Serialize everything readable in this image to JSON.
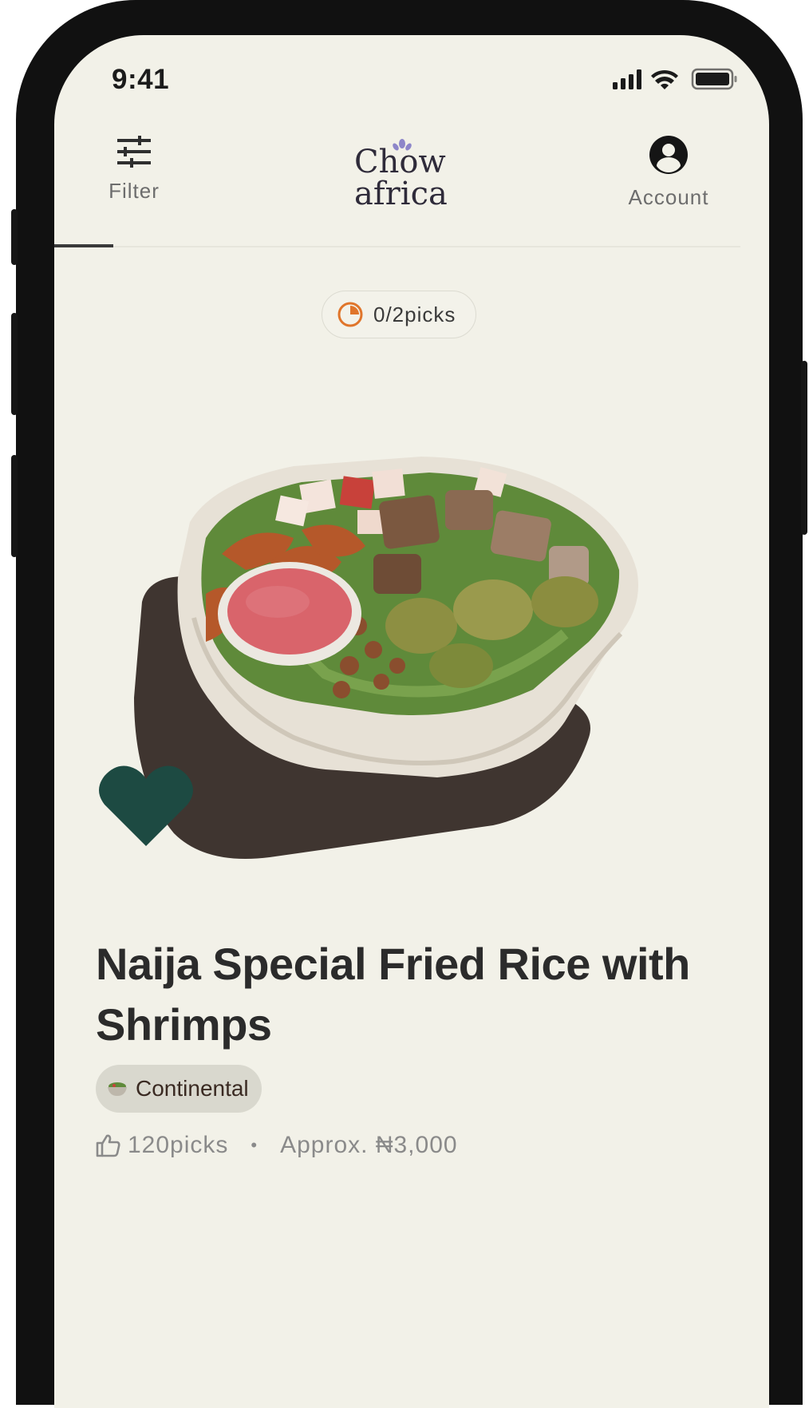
{
  "status_bar": {
    "time": "9:41",
    "icons": [
      "cellular-signal-icon",
      "wifi-icon",
      "battery-icon"
    ]
  },
  "header": {
    "filter_label": "Filter",
    "logo_line1": "Chow",
    "logo_line2": "africa",
    "account_label": "Account"
  },
  "picks_counter": {
    "text": "0/2picks"
  },
  "dish": {
    "title": "Naija Special Fried Rice with Shrimps",
    "category": "Continental",
    "likes": "120picks",
    "separator": "•",
    "price": "Approx. ₦3,000",
    "favorited": true
  },
  "colors": {
    "background": "#f2f1e8",
    "accent_green": "#1d4a42",
    "accent_orange": "#e0752b",
    "text_dark": "#2b2b2b",
    "text_muted": "#8a8a8a",
    "chip_bg": "#d9d8ce"
  }
}
